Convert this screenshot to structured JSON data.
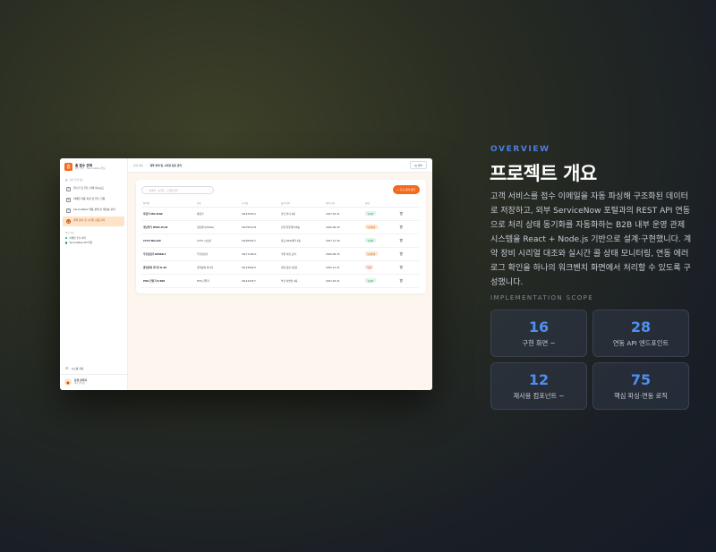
{
  "mockup": {
    "brand": {
      "logo": "홈",
      "title": "홈 접수 관제",
      "subtitle": "외부 접수 · ServiceNow 연동"
    },
    "section_label": "내부 운영 메뉴",
    "nav_items": [
      {
        "label": "접수건 홈 접수 관제 대시보드",
        "icon": "home-icon",
        "active": false
      },
      {
        "label": "이메일 자동 파싱 및 접수 현황",
        "icon": "mail-icon",
        "active": false
      },
      {
        "label": "ServiceNow 연동 상태 및 재전송 관리",
        "icon": "sync-icon",
        "active": false
      },
      {
        "label": "계약 장비 및 시리얼 검증 관리",
        "icon": "device-icon",
        "active": true
      }
    ],
    "external_title": "외부 연동",
    "external_items": [
      "이메일 수신 서버",
      "ServiceNow API 연결"
    ],
    "system_settings": "시스템 설정",
    "user": {
      "name": "운영 관리자",
      "role": "내부 운영팀"
    },
    "breadcrumb": {
      "parent": "관리 메뉴",
      "current": "계약 장비 및 시리얼 검증 관리"
    },
    "top_button": "필터",
    "search_placeholder": "장비명 · 시리얼 · 고객명 검색",
    "add_button": "+ 신규 장비 등록",
    "table": {
      "headers": [
        "장비명",
        "분류",
        "시리얼",
        "설치 위치",
        "계약 만료",
        "상태",
        ""
      ],
      "rows": [
        {
          "name": "복합기 MX-4100",
          "type": "복합기",
          "serial": "SN-43253-A",
          "location": "강남 본사 3층",
          "expire": "2027-03-31",
          "status": "유지중",
          "tone": "green"
        },
        {
          "name": "냉난방기 HVAC-Pro8",
          "type": "냉난방기(HVAC)",
          "serial": "SN-78512-B",
          "location": "인천 물류센터 B동",
          "expire": "2026-06-30",
          "status": "만료임박",
          "tone": "orange"
        },
        {
          "name": "CCTV NX-220",
          "type": "CCTV 시스템",
          "serial": "SN-98445-C",
          "location": "판교 R&D센터 1동",
          "expire": "2027-11-30",
          "status": "유지중",
          "tone": "green"
        },
        {
          "name": "무인점검기 KIOSK-7",
          "type": "무인점검기",
          "serial": "SN-77128-D",
          "location": "수원 지점 로비",
          "expire": "2026-08-15",
          "status": "만료임박",
          "tone": "orange"
        },
        {
          "name": "출입통제 리더기 R-30",
          "type": "출입통제 리더기",
          "serial": "SN-33849-E",
          "location": "대전 공장 2공장",
          "expire": "2025-12-31",
          "status": "만료",
          "tone": "red"
        },
        {
          "name": "POS 단말기 P-500",
          "type": "POS 단말기",
          "serial": "SN-43253-F",
          "location": "부산 서면점 3층",
          "expire": "2027-05-31",
          "status": "유지중",
          "tone": "green"
        }
      ]
    }
  },
  "panel": {
    "overline": "OVERVIEW",
    "title": "프로젝트 개요",
    "description": "고객 서비스를 접수 이메일을 자동 파싱해 구조화된 데이터로 저장하고, 외부 ServiceNow 포털과의 REST API 연동으로 처리 상태 동기화를 자동화하는 B2B 내부 운영 관제 시스템을 React + Node.js 기반으로 설계·구현했니다. 계약 장비 시리얼 대조와 실시간 콜 상태 모니터링, 연동 에러 로그 확인을 하나의 워크벤치 화면에서 처리할 수 있도록 구성했니다.",
    "scope_label": "IMPLEMENTATION SCOPE",
    "stats": [
      {
        "value": "16",
        "label": "구현 화면 ~"
      },
      {
        "value": "28",
        "label": "연동 API 엔드포인트"
      },
      {
        "value": "12",
        "label": "재사용 컴포넌트 ~"
      },
      {
        "value": "75",
        "label": "핵심 파싱·연동 로직"
      }
    ]
  },
  "colors": {
    "accent": "#f26b1d",
    "blue": "#4f8ff0",
    "green": "#1f8a4c",
    "red": "#c83a2e"
  }
}
